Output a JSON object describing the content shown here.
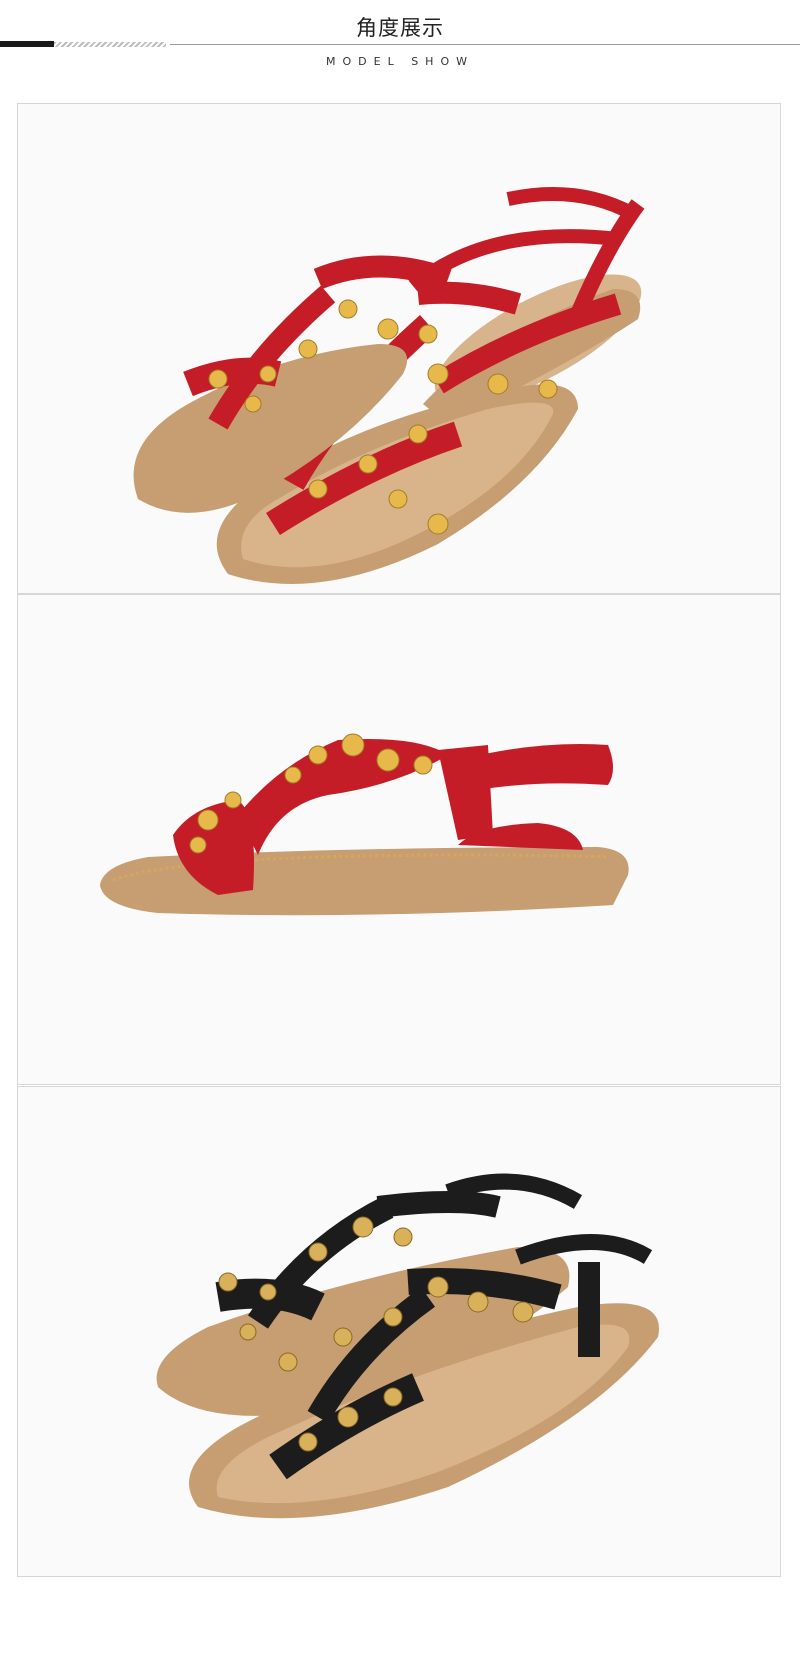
{
  "header": {
    "title": "角度展示",
    "subtitle": "MODEL SHOW"
  },
  "panels": [
    {
      "view": "pair-angled",
      "color": "#c8202a",
      "strap_color": "#c41d27",
      "sole_color": "#c79d72"
    },
    {
      "view": "single-side",
      "color": "#c8202a",
      "strap_color": "#c41d27",
      "sole_color": "#c79d72"
    },
    {
      "view": "pair-angled",
      "color": "#151515",
      "strap_color": "#1c1c1c",
      "sole_color": "#c79d72"
    }
  ]
}
